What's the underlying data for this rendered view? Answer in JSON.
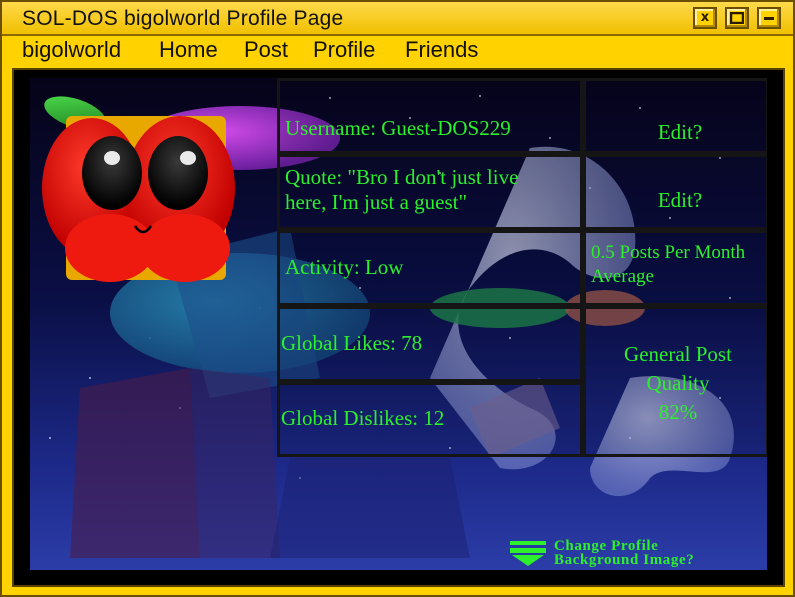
{
  "window": {
    "title": "SOL-DOS bigolworld Profile Page",
    "buttons": {
      "close": "x",
      "maximize": "▢",
      "minimize": "–"
    }
  },
  "menu": [
    "bigolworld",
    "Home",
    "Post",
    "Profile",
    "Friends"
  ],
  "profile": {
    "username": "Username: Guest-DOS229",
    "quote_line1": "Quote:  \"Bro I don't just live",
    "quote_line2": "here, I'm just a guest\"",
    "activity": "Activity: Low",
    "global_likes": "Global Likes: 78",
    "global_dislikes": "Global Dislikes: 12",
    "edit_username": "Edit?",
    "edit_quote": "Edit?",
    "posts_rate_line1": "0.5 Posts Per Month",
    "posts_rate_line2": "Average",
    "quality_line1": "General Post",
    "quality_line2": "Quality",
    "quality_line3": "82%"
  },
  "change_background": {
    "line1": "Change Profile",
    "line2": "Background Image?"
  },
  "colors": {
    "window_yellow": "#ffd200",
    "text_green": "#2cf02c",
    "grid_border": "#151515"
  },
  "icons": [
    "arrow-down-icon",
    "avatar-icon",
    "close-icon",
    "maximize-icon",
    "minimize-icon"
  ]
}
